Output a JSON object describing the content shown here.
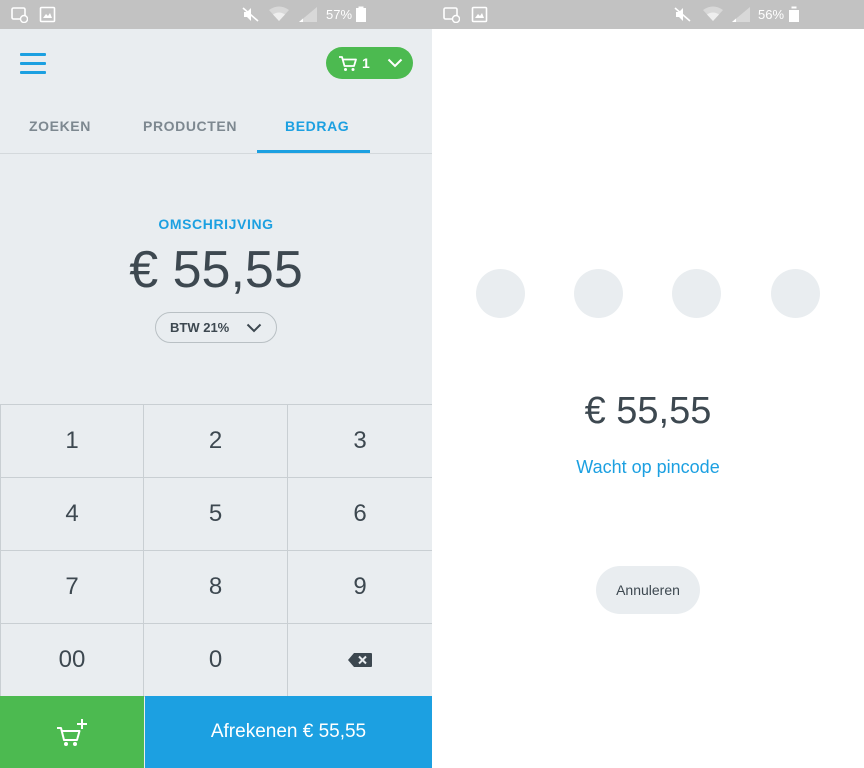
{
  "left_screen": {
    "statusbar": {
      "battery_text": "57%"
    },
    "header": {
      "cart_count": "1"
    },
    "tabs": [
      {
        "label": "ZOEKEN"
      },
      {
        "label": "PRODUCTEN"
      },
      {
        "label": "BEDRAG",
        "active": true
      }
    ],
    "description_label": "OMSCHRIJVING",
    "amount": "€ 55,55",
    "vat_select": {
      "selected": "BTW 21%"
    },
    "keypad": {
      "keys": [
        "1",
        "2",
        "3",
        "4",
        "5",
        "6",
        "7",
        "8",
        "9",
        "00",
        "0"
      ],
      "backspace_icon": "backspace-icon"
    },
    "add_to_cart_icon": "cart-plus-icon",
    "checkout_label": "Afrekenen € 55,55"
  },
  "right_screen": {
    "statusbar": {
      "battery_text": "56%"
    },
    "pin_dots": 4,
    "amount": "€ 55,55",
    "status": "Wacht op pincode",
    "cancel_label": "Annuleren"
  },
  "colors": {
    "accent_blue": "#1ca0e1",
    "accent_green": "#4cba50",
    "text_dark": "#3d4850",
    "background_gray": "#e9edf0"
  }
}
